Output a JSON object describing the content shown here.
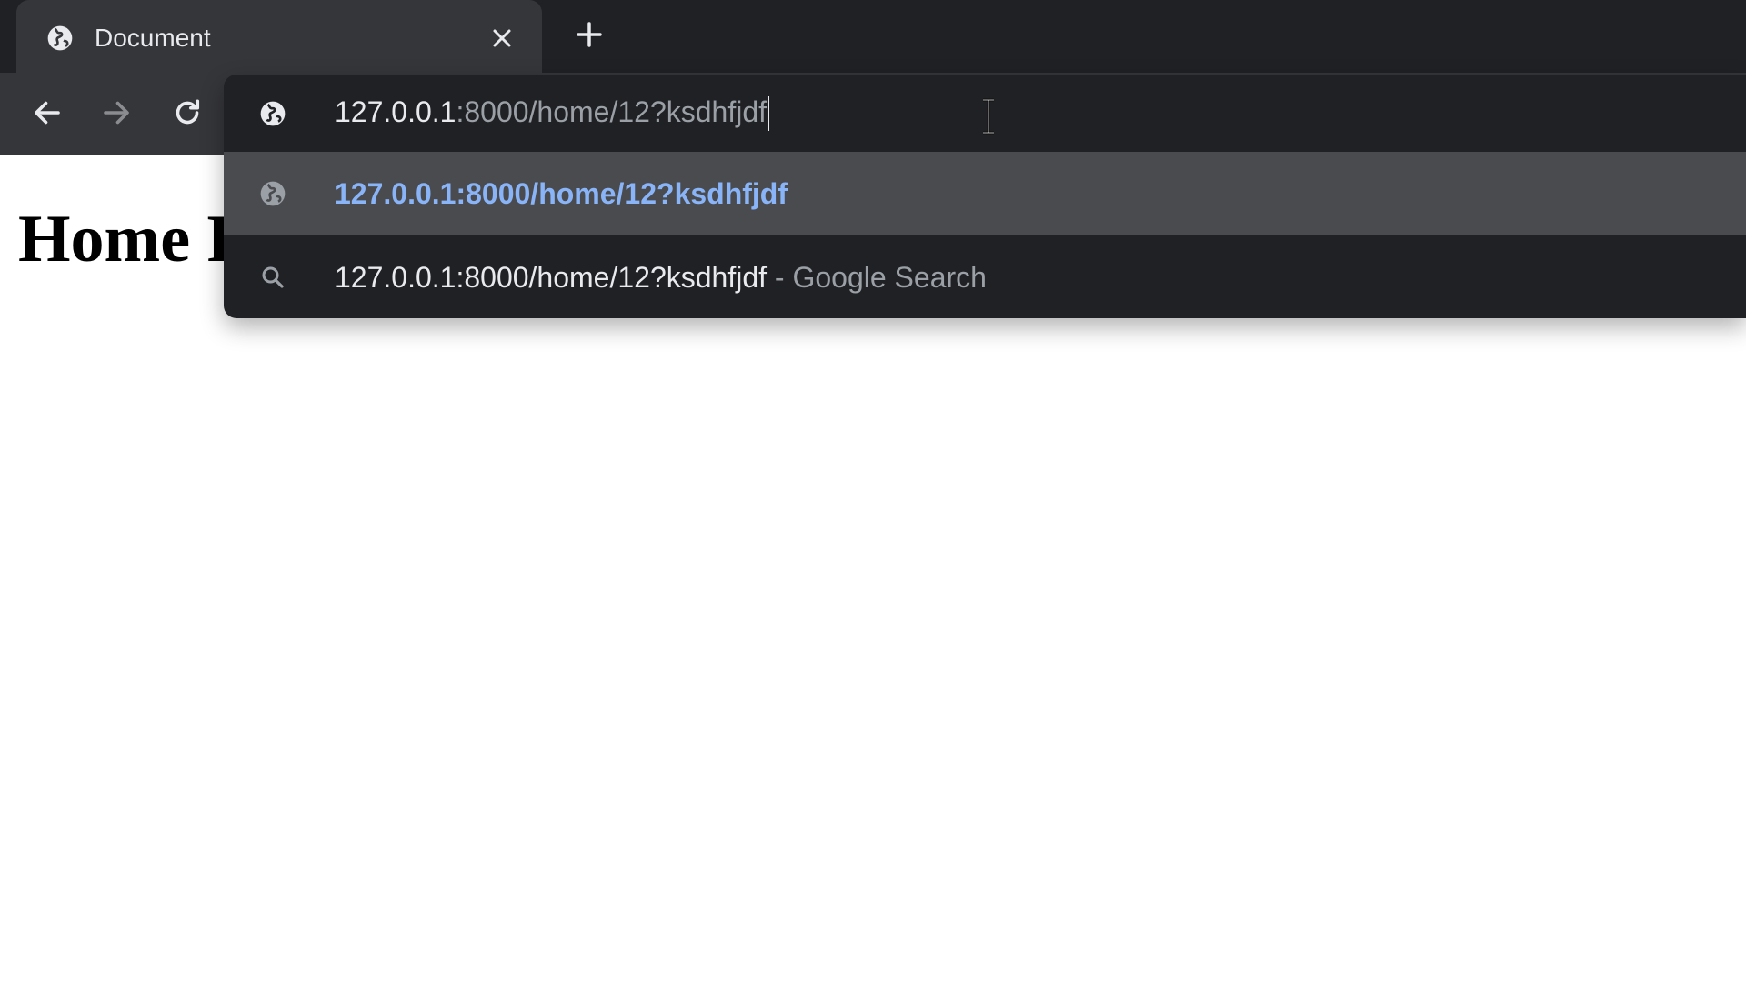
{
  "browser": {
    "tab": {
      "title": "Document",
      "icon": "globe-icon"
    },
    "new_tab_icon": "plus-icon",
    "nav": {
      "back_icon": "arrow-left-icon",
      "forward_icon": "arrow-right-icon",
      "reload_icon": "reload-icon"
    },
    "omnibox": {
      "typed_text": "127.0.0.1",
      "autocomplete_suffix": ":8000/home/12?ksdhfjdf",
      "icon": "globe-icon",
      "suggestions": [
        {
          "icon": "globe-icon",
          "text": "127.0.0.1:8000/home/12?ksdhfjdf"
        },
        {
          "icon": "search-icon",
          "text": "127.0.0.1:8000/home/12?ksdhfjdf",
          "provider": " - Google Search"
        }
      ]
    }
  },
  "page": {
    "heading": "Home Page"
  },
  "colors": {
    "toolbar": "#35363a",
    "tabstrip": "#202124",
    "omnibox_bg": "#202124",
    "highlight_row": "#4a4b4f",
    "link_blue": "#8ab4f8",
    "muted_text": "#9aa0a6"
  }
}
